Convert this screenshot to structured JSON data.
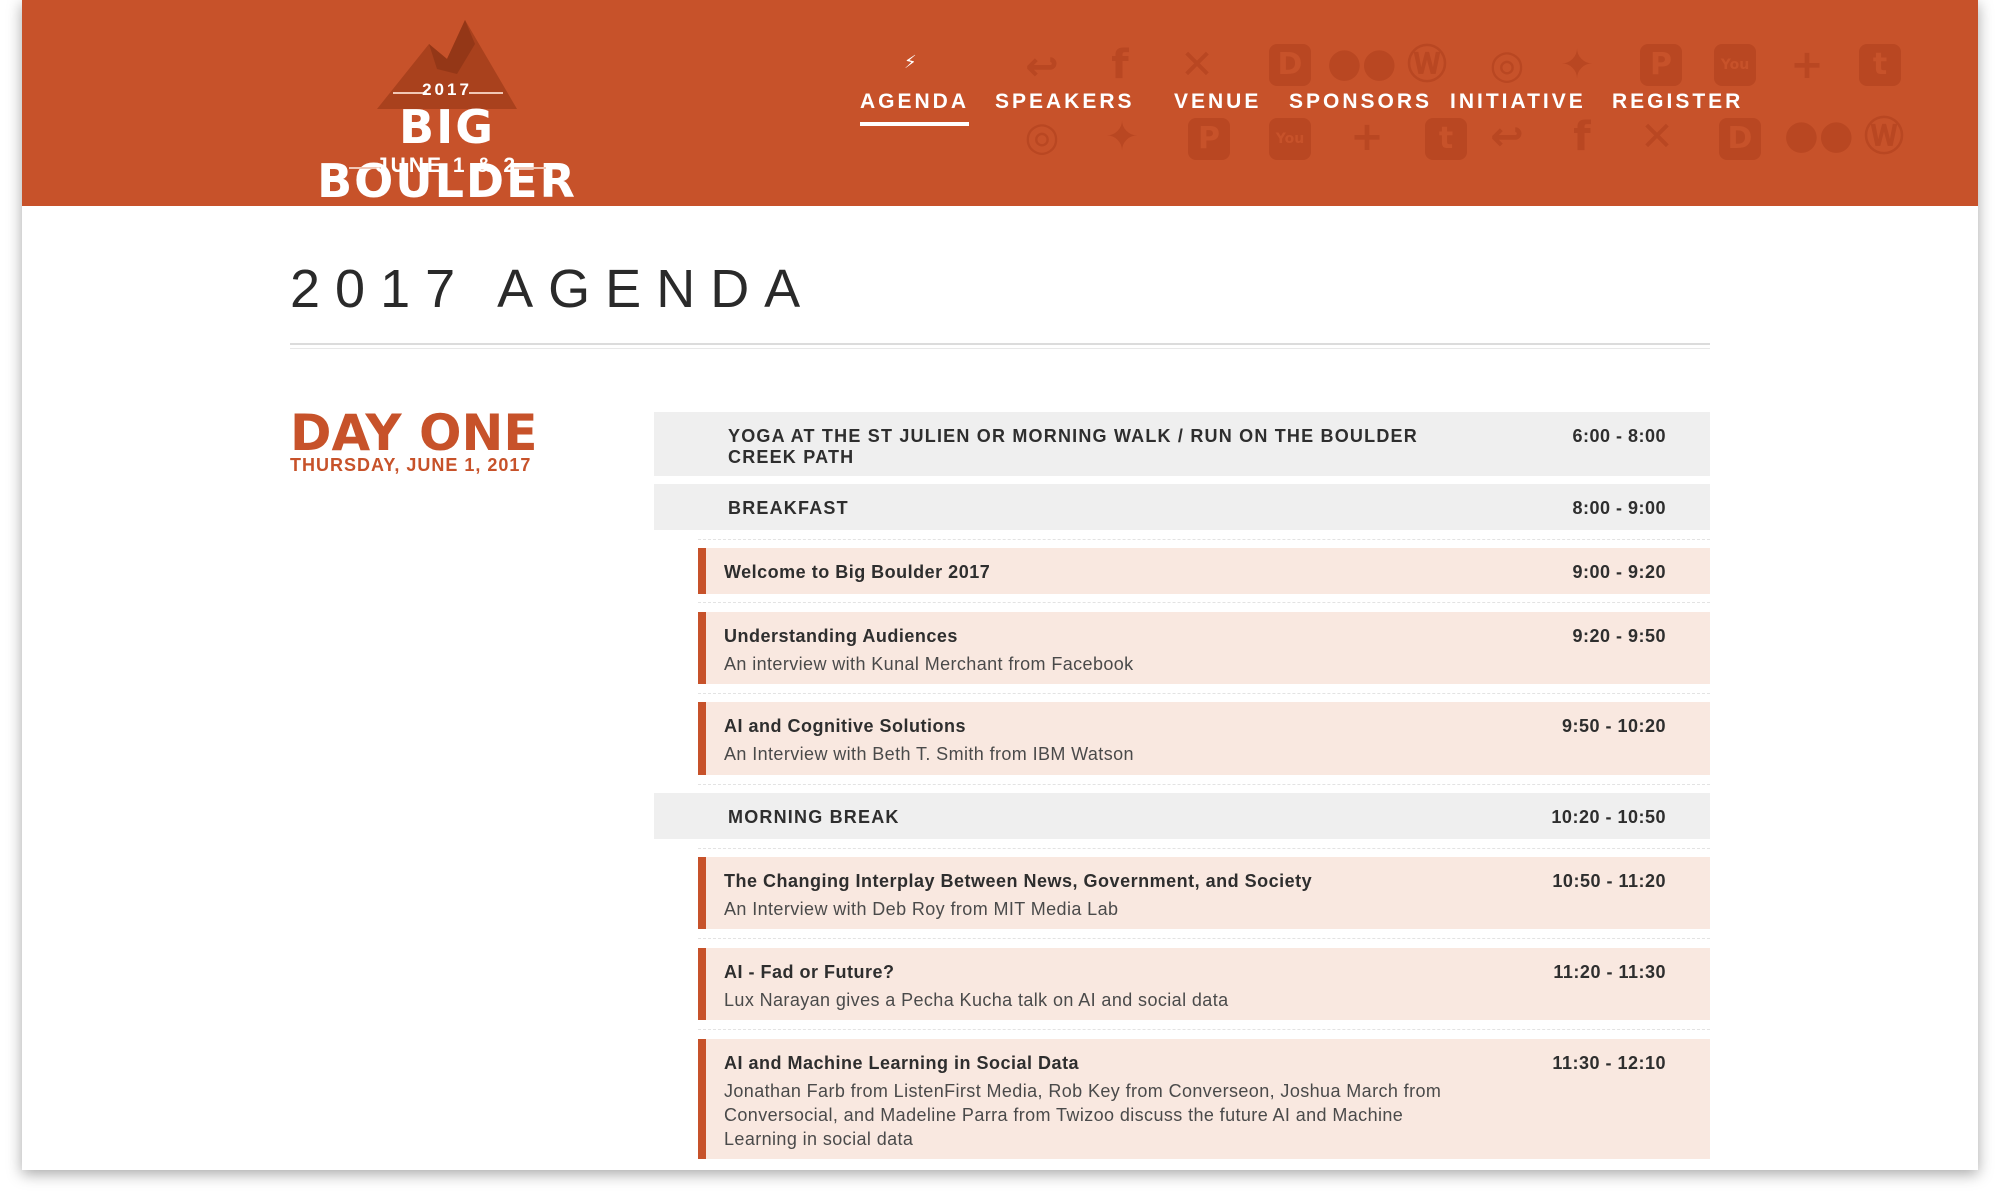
{
  "header": {
    "logo": {
      "year": "2017",
      "title": "BIG BOULDER",
      "dates": "JUNE 1 & 2"
    },
    "nav": [
      {
        "label": "AGENDA",
        "active": true
      },
      {
        "label": "SPEAKERS",
        "active": false
      },
      {
        "label": "VENUE",
        "active": false
      },
      {
        "label": "SPONSORS",
        "active": false
      },
      {
        "label": "INITIATIVE",
        "active": false
      },
      {
        "label": "REGISTER",
        "active": false
      }
    ],
    "background_icons": [
      "buffer-icon",
      "facebook-icon",
      "xing-icon",
      "disqus-icon",
      "flickr-icon",
      "wordpress-icon",
      "instagram-icon",
      "twitter-icon",
      "pinterest-icon",
      "youtube-icon",
      "google-plus-icon",
      "tumblr-icon"
    ]
  },
  "colors": {
    "brand": "#c7522a",
    "gray_row": "#efefef",
    "talk_row": "#f9e8e0"
  },
  "page": {
    "title": "2017 AGENDA"
  },
  "day": {
    "heading": "DAY ONE",
    "date": "THURSDAY, JUNE 1, 2017"
  },
  "agenda": [
    {
      "type": "general",
      "title": "YOGA AT THE ST JULIEN OR MORNING WALK / RUN ON THE BOULDER CREEK PATH",
      "time": "6:00 - 8:00"
    },
    {
      "type": "general",
      "title": "BREAKFAST",
      "time": "8:00 - 9:00"
    },
    {
      "type": "talk",
      "title": "Welcome to Big Boulder 2017",
      "desc": "",
      "time": "9:00 - 9:20"
    },
    {
      "type": "talk",
      "title": "Understanding Audiences",
      "desc": "An interview with Kunal Merchant from Facebook",
      "time": "9:20 - 9:50"
    },
    {
      "type": "talk",
      "title": "AI and Cognitive Solutions",
      "desc": "An Interview with Beth T. Smith from IBM Watson",
      "time": "9:50 - 10:20"
    },
    {
      "type": "general",
      "title": "MORNING BREAK",
      "time": "10:20 - 10:50"
    },
    {
      "type": "talk",
      "title": "The Changing Interplay Between News, Government, and Society",
      "desc": "An Interview with Deb Roy from MIT Media Lab",
      "time": "10:50 - 11:20"
    },
    {
      "type": "talk",
      "title": "AI - Fad or Future?",
      "desc": "Lux Narayan gives a Pecha Kucha talk on AI and social data",
      "time": "11:20 - 11:30"
    },
    {
      "type": "talk",
      "title": "AI and Machine Learning in Social Data",
      "desc": "Jonathan Farb from ListenFirst Media, Rob Key from Converseon, Joshua March from Conversocial, and Madeline Parra from Twizoo discuss the future AI and Machine Learning in social data",
      "time": "11:30 - 12:10"
    }
  ]
}
